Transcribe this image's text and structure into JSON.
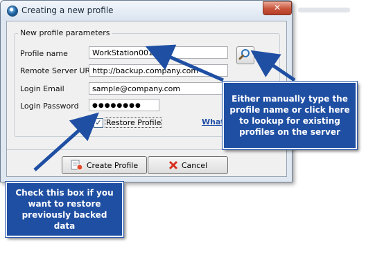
{
  "window": {
    "title": "Creating a new profile",
    "close_glyph": "✕",
    "icon": "app-globe-icon"
  },
  "group": {
    "legend": "New profile parameters"
  },
  "form": {
    "profile_name": {
      "label": "Profile name",
      "value": "WorkStation001"
    },
    "server_url": {
      "label": "Remote Server URL",
      "value": "http://backup.company.com"
    },
    "login_email": {
      "label": "Login Email",
      "value": "sample@company.com"
    },
    "login_password": {
      "label": "Login Password",
      "value": "●●●●●●●●"
    },
    "restore_profile": {
      "label": "Restore Profile",
      "checked": true,
      "glyph": "✓"
    },
    "help_link": "What"
  },
  "buttons": {
    "create_profile": "Create Profile",
    "cancel": "Cancel"
  },
  "callouts": {
    "lookup": "Either manually type the profile name or click here to lookup for existing profiles on the server",
    "restore": "Check this box if you want to restore previously backed data"
  },
  "colors": {
    "callout_bg": "#1f4fa3",
    "arrow": "#1f4fa3"
  }
}
